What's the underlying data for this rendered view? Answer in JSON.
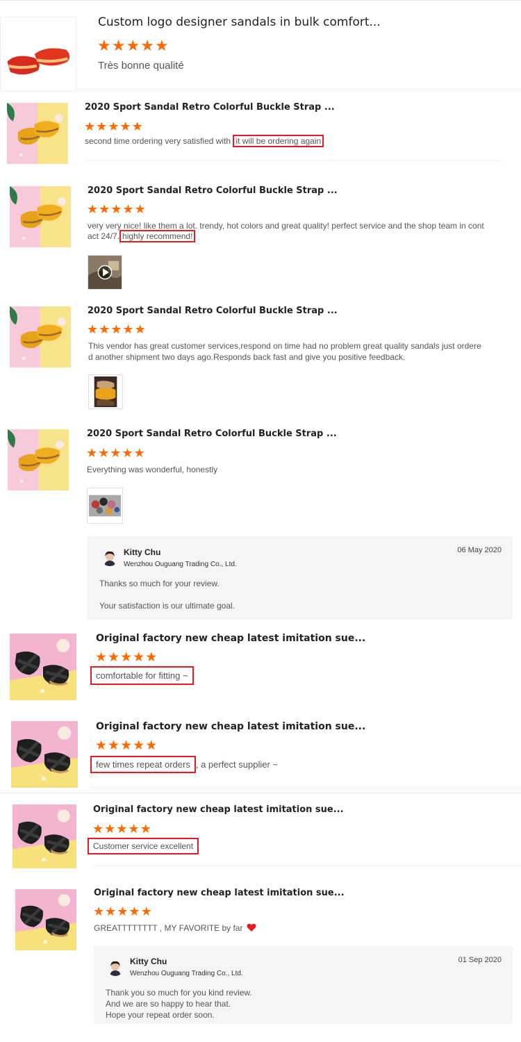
{
  "reviews": [
    {
      "title": "Custom logo designer sandals in bulk comfort...",
      "text": "Très bonne qualité",
      "stars": 5
    },
    {
      "title": "2020 Sport Sandal Retro Colorful Buckle Strap ...",
      "text_before": "second time ordering very satisfied with ",
      "text_hl": "it will be ordering again",
      "stars": 5
    },
    {
      "title": "2020 Sport Sandal Retro Colorful Buckle Strap ...",
      "text_line1": "very very nice! like them a lot. trendy, hot colors and great quality! perfect service and the shop team in cont",
      "text_line2_before": "act 24/7.",
      "text_hl": "highly recommend!",
      "stars": 5
    },
    {
      "title": "2020 Sport Sandal Retro Colorful Buckle Strap ...",
      "text_line1": "This vendor has great customer services,respond on time had no problem great quality sandals just ordere",
      "text_line2": "d another shipment two days ago.Responds back fast and give you positive feedback.",
      "stars": 5
    },
    {
      "title": "2020 Sport Sandal Retro Colorful Buckle Strap ...",
      "text": "Everything was wonderful, honestly",
      "stars": 5
    },
    {
      "title": "Original factory new cheap latest imitation sue...",
      "text_hl": "comfortable for fitting ~",
      "stars": 5
    },
    {
      "title": "Original factory new cheap latest imitation sue...",
      "text_hl": "few times repeat orders",
      "text_after": ", a perfect supplier ~",
      "stars": 5
    },
    {
      "title": "Original factory new cheap latest imitation sue...",
      "text_hl": "Customer service excellent",
      "stars": 5
    },
    {
      "title": "Original factory new cheap latest imitation sue...",
      "text": "GREATTTTTTTT , MY FAVORITE by far",
      "stars": 5
    }
  ],
  "replies": [
    {
      "name": "Kitty Chu",
      "company": "Wenzhou Ouguang Trading Co., Ltd.",
      "date": "06 May 2020",
      "line1": "Thanks so much for your review.",
      "line2": "Your satisfaction is our ultimate goal."
    },
    {
      "name": "Kitty Chu",
      "company": "Wenzhou Ouguang Trading Co., Ltd.",
      "date": "01 Sep 2020",
      "line1": "Thank you so much for you kind review.",
      "line2": "And we are so happy to hear that.",
      "line3": "Hope your repeat order soon."
    }
  ],
  "star_glyph": "★",
  "colors": {
    "star": "#ff6a00",
    "highlight_border": "#e31b23",
    "reply_bg": "#f4f5f7",
    "heart": "#e31b23"
  }
}
